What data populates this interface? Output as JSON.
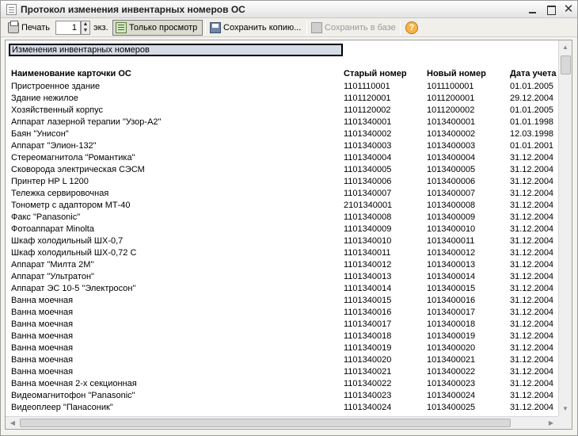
{
  "window": {
    "title": "Протокол изменения инвентарных номеров ОС"
  },
  "toolbar": {
    "print_label": "Печать",
    "copies_value": "1",
    "copies_unit": "экз.",
    "view_only_label": "Только просмотр",
    "save_copy_label": "Сохранить копию...",
    "save_db_label": "Сохранить в базе",
    "help_label": "?"
  },
  "report": {
    "header": "Изменения инвентарных номеров",
    "columns": [
      "Наименование карточки ОС",
      "Старый номер",
      "Новый номер",
      "Дата учета"
    ],
    "rows": [
      {
        "name": "Пристроенное здание",
        "old": "1101110001",
        "new": "1011100001",
        "date": "01.01.2005"
      },
      {
        "name": "Здание нежилое",
        "old": "1101120001",
        "new": "1011200001",
        "date": "29.12.2004"
      },
      {
        "name": "Хозяйственный корпус",
        "old": "1101120002",
        "new": "1011200002",
        "date": "01.01.2005"
      },
      {
        "name": "Аппарат лазерной терапии \"Узор-А2\"",
        "old": "1101340001",
        "new": "1013400001",
        "date": "01.01.1998"
      },
      {
        "name": "Баян \"Унисон\"",
        "old": "1101340002",
        "new": "1013400002",
        "date": "12.03.1998"
      },
      {
        "name": "Аппарат \"Элион-132\"",
        "old": "1101340003",
        "new": "1013400003",
        "date": "01.01.2001"
      },
      {
        "name": "Стереомагнитола \"Романтика\"",
        "old": "1101340004",
        "new": "1013400004",
        "date": "31.12.2004"
      },
      {
        "name": "Сковорода электрическая СЭСМ",
        "old": "1101340005",
        "new": "1013400005",
        "date": "31.12.2004"
      },
      {
        "name": "Принтер HP L 1200",
        "old": "1101340006",
        "new": "1013400006",
        "date": "31.12.2004"
      },
      {
        "name": "Тележка сервировочная",
        "old": "1101340007",
        "new": "1013400007",
        "date": "31.12.2004"
      },
      {
        "name": "Тонометр с адаптором МТ-40",
        "old": "2101340001",
        "new": "1013400008",
        "date": "31.12.2004"
      },
      {
        "name": "Факс \"Panasonic\"",
        "old": "1101340008",
        "new": "1013400009",
        "date": "31.12.2004"
      },
      {
        "name": "Фотоаппарат Minolta",
        "old": "1101340009",
        "new": "1013400010",
        "date": "31.12.2004"
      },
      {
        "name": "Шкаф холодильный ШХ-0,7",
        "old": "1101340010",
        "new": "1013400011",
        "date": "31.12.2004"
      },
      {
        "name": "Шкаф холодильный ШХ-0,72 С",
        "old": "1101340011",
        "new": "1013400012",
        "date": "31.12.2004"
      },
      {
        "name": "Аппарат \"Милта 2М\"",
        "old": "1101340012",
        "new": "1013400013",
        "date": "31.12.2004"
      },
      {
        "name": "Аппарат \"Ультратон\"",
        "old": "1101340013",
        "new": "1013400014",
        "date": "31.12.2004"
      },
      {
        "name": "Аппарат ЭС 10-5 \"Электросон\"",
        "old": "1101340014",
        "new": "1013400015",
        "date": "31.12.2004"
      },
      {
        "name": "Ванна моечная",
        "old": "1101340015",
        "new": "1013400016",
        "date": "31.12.2004"
      },
      {
        "name": "Ванна моечная",
        "old": "1101340016",
        "new": "1013400017",
        "date": "31.12.2004"
      },
      {
        "name": "Ванна моечная",
        "old": "1101340017",
        "new": "1013400018",
        "date": "31.12.2004"
      },
      {
        "name": "Ванна моечная",
        "old": "1101340018",
        "new": "1013400019",
        "date": "31.12.2004"
      },
      {
        "name": "Ванна моечная",
        "old": "1101340019",
        "new": "1013400020",
        "date": "31.12.2004"
      },
      {
        "name": "Ванна моечная",
        "old": "1101340020",
        "new": "1013400021",
        "date": "31.12.2004"
      },
      {
        "name": "Ванна моечная",
        "old": "1101340021",
        "new": "1013400022",
        "date": "31.12.2004"
      },
      {
        "name": "Ванна моечная 2-х секционная",
        "old": "1101340022",
        "new": "1013400023",
        "date": "31.12.2004"
      },
      {
        "name": "Видеомагнитофон \"Panasonic\"",
        "old": "1101340023",
        "new": "1013400024",
        "date": "31.12.2004"
      },
      {
        "name": "Видеоплеер \"Панасоник\"",
        "old": "1101340024",
        "new": "1013400025",
        "date": "31.12.2004"
      }
    ]
  }
}
